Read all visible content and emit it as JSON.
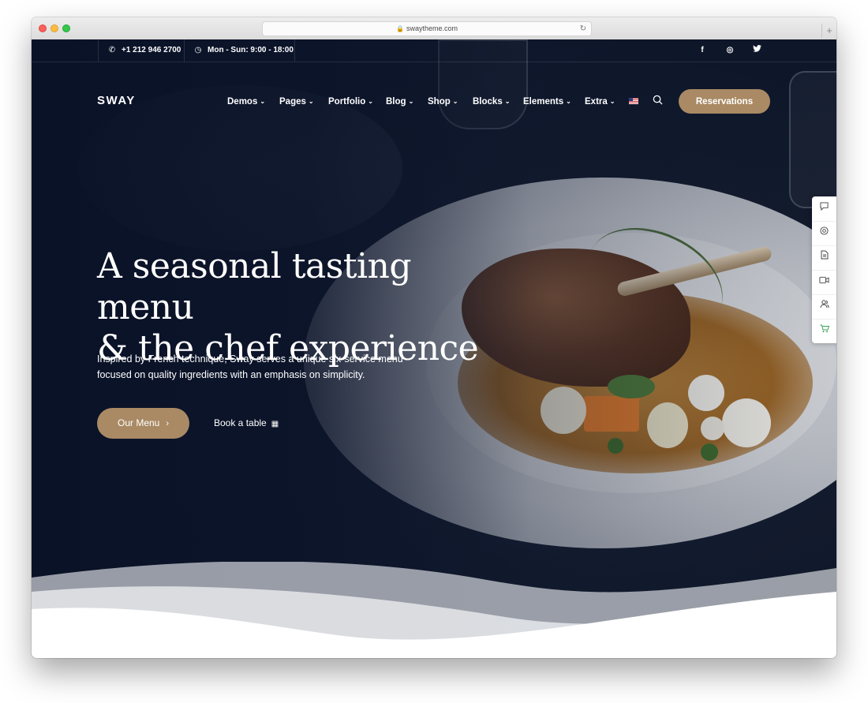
{
  "browser": {
    "url": "swaytheme.com"
  },
  "topbar": {
    "phone": "+1 212 946 2700",
    "hours": "Mon - Sun: 9:00 - 18:00",
    "social": [
      {
        "icon": "facebook-icon",
        "glyph": "f"
      },
      {
        "icon": "instagram-icon",
        "glyph": "◎"
      },
      {
        "icon": "twitter-icon",
        "glyph": "🐦"
      }
    ]
  },
  "header": {
    "logo": "SWAY",
    "nav": [
      "Demos",
      "Pages",
      "Portfolio",
      "Blog",
      "Shop",
      "Blocks",
      "Elements",
      "Extra"
    ],
    "reservations_label": "Reservations"
  },
  "hero": {
    "headline_line1": "A seasonal tasting menu",
    "headline_line2": "& the chef experience",
    "subtext_line1": "Inspired by French technique, Sway serves a unique six-service menu",
    "subtext_line2": "focused on quality ingredients with an emphasis on simplicity.",
    "primary_button": "Our Menu",
    "secondary_link": "Book a table"
  },
  "side_toolbar": [
    {
      "icon": "chat-icon",
      "glyph": "▭"
    },
    {
      "icon": "support-icon",
      "glyph": "◎"
    },
    {
      "icon": "document-icon",
      "glyph": "▤"
    },
    {
      "icon": "video-icon",
      "glyph": "▷"
    },
    {
      "icon": "users-icon",
      "glyph": "☺"
    },
    {
      "icon": "cart-icon",
      "glyph": "🛒"
    }
  ],
  "colors": {
    "accent": "#a98a64",
    "hero_dark": "#0f1a33",
    "cart_green": "#3aa35a"
  }
}
